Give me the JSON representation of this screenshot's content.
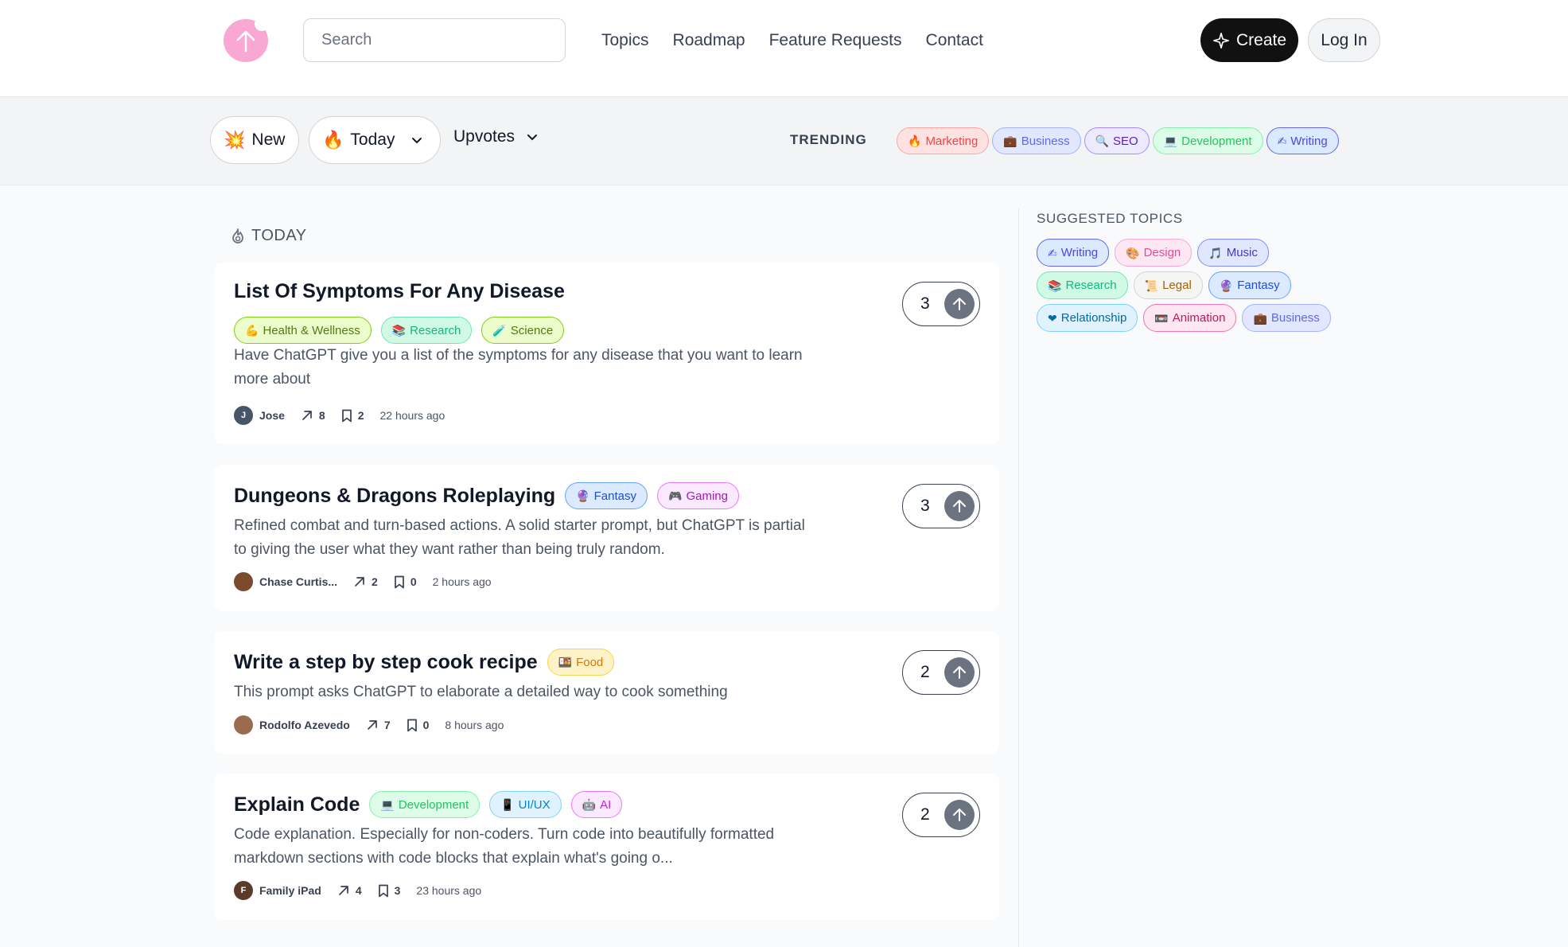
{
  "header": {
    "search_placeholder": "Search",
    "nav": [
      "Topics",
      "Roadmap",
      "Feature Requests",
      "Contact"
    ],
    "create_label": "Create",
    "login_label": "Log In"
  },
  "filters": {
    "new_label": "New",
    "new_icon": "💥",
    "today_label": "Today",
    "today_icon": "🔥",
    "sort_label": "Upvotes",
    "trending_label": "TRENDING",
    "trending_tags": [
      {
        "icon": "🔥",
        "label": "Marketing",
        "bg": "#fee2e2",
        "border": "#fca5a5",
        "color": "#ef4444"
      },
      {
        "icon": "💼",
        "label": "Business",
        "bg": "#e0e7ff",
        "border": "#a5b4fc",
        "color": "#6366f1"
      },
      {
        "icon": "🔍",
        "label": "SEO",
        "bg": "#ede9fe",
        "border": "#a78bfa",
        "color": "#5b21b6"
      },
      {
        "icon": "💻",
        "label": "Development",
        "bg": "#dcfce7",
        "border": "#86efac",
        "color": "#22c55e"
      },
      {
        "icon": "✍",
        "label": "Writing",
        "bg": "#dbeafe",
        "border": "#6366f1",
        "color": "#4f46e5"
      }
    ]
  },
  "feed": {
    "section_label": "TODAY",
    "posts": [
      {
        "title": "List Of Symptoms For Any Disease",
        "tags": [
          {
            "icon": "💪",
            "label": "Health & Wellness",
            "bg": "#ecfccb",
            "border": "#84cc16",
            "color": "#4d7c0f"
          },
          {
            "icon": "📚",
            "label": "Research",
            "bg": "#d1fae5",
            "border": "#6ee7b7",
            "color": "#10b981"
          },
          {
            "icon": "🧪",
            "label": "Science",
            "bg": "#ecfccb",
            "border": "#84cc16",
            "color": "#4d7c0f"
          }
        ],
        "desc": "Have ChatGPT give you a list of the symptoms for any disease that you want to learn more about",
        "author": "Jose",
        "author_initial": "J",
        "avatar_color": "#475569",
        "shares": "8",
        "saves": "2",
        "time": "22 hours ago",
        "votes": "3"
      },
      {
        "title": "Dungeons & Dragons Roleplaying",
        "tags": [
          {
            "icon": "🔮",
            "label": "Fantasy",
            "bg": "#dbeafe",
            "border": "#60a5fa",
            "color": "#1d4ed8"
          },
          {
            "icon": "🎮",
            "label": "Gaming",
            "bg": "#fae8ff",
            "border": "#e879f9",
            "color": "#a21caf"
          }
        ],
        "desc": "Refined combat and turn-based actions. A solid starter prompt, but ChatGPT is partial to giving the user what they want rather than being truly random.",
        "author": "Chase Curtis...",
        "author_initial": "",
        "avatar_color": "#7c4a2d",
        "shares": "2",
        "saves": "0",
        "time": "2 hours ago",
        "votes": "3"
      },
      {
        "title": "Write a step by step cook recipe",
        "tags": [
          {
            "icon": "🍱",
            "label": "Food",
            "bg": "#fef3c7",
            "border": "#fcd34d",
            "color": "#d97706"
          }
        ],
        "desc": "This prompt asks ChatGPT to elaborate a detailed way to cook something",
        "author": "Rodolfo Azevedo",
        "author_initial": "",
        "avatar_color": "#9a6b4f",
        "shares": "7",
        "saves": "0",
        "time": "8 hours ago",
        "votes": "2"
      },
      {
        "title": "Explain Code",
        "tags": [
          {
            "icon": "💻",
            "label": "Development",
            "bg": "#dcfce7",
            "border": "#86efac",
            "color": "#22c55e"
          },
          {
            "icon": "📱",
            "label": "UI/UX",
            "bg": "#e0f2fe",
            "border": "#7dd3fc",
            "color": "#0284c7"
          },
          {
            "icon": "🤖",
            "label": "AI",
            "bg": "#fae8ff",
            "border": "#e879f9",
            "color": "#c026d3"
          }
        ],
        "desc": "Code explanation. Especially for non-coders. Turn code into beautifully formatted markdown sections with code blocks that explain what's going o...",
        "author": "Family iPad",
        "author_initial": "F",
        "avatar_color": "#5b3a29",
        "shares": "4",
        "saves": "3",
        "time": "23 hours ago",
        "votes": "2"
      }
    ]
  },
  "sidebar": {
    "title": "SUGGESTED TOPICS",
    "topics": [
      {
        "icon": "✍",
        "label": "Writing",
        "bg": "#dbeafe",
        "border": "#6366f1",
        "color": "#4f46e5"
      },
      {
        "icon": "🎨",
        "label": "Design",
        "bg": "#fce7f3",
        "border": "#f9a8d4",
        "color": "#ec4899"
      },
      {
        "icon": "🎵",
        "label": "Music",
        "bg": "#e0e7ff",
        "border": "#818cf8",
        "color": "#4338ca"
      },
      {
        "icon": "📚",
        "label": "Research",
        "bg": "#d1fae5",
        "border": "#6ee7b7",
        "color": "#10b981"
      },
      {
        "icon": "📜",
        "label": "Legal",
        "bg": "#f5f5f4",
        "border": "#d6d3d1",
        "color": "#a16207"
      },
      {
        "icon": "🔮",
        "label": "Fantasy",
        "bg": "#dbeafe",
        "border": "#60a5fa",
        "color": "#1d4ed8"
      },
      {
        "icon": "❤",
        "label": "Relationship",
        "bg": "#e0f2fe",
        "border": "#7dd3fc",
        "color": "#0369a1"
      },
      {
        "icon": "📼",
        "label": "Animation",
        "bg": "#fce7f3",
        "border": "#f472b6",
        "color": "#be185d"
      },
      {
        "icon": "💼",
        "label": "Business",
        "bg": "#e0e7ff",
        "border": "#a5b4fc",
        "color": "#6366f1"
      }
    ]
  }
}
